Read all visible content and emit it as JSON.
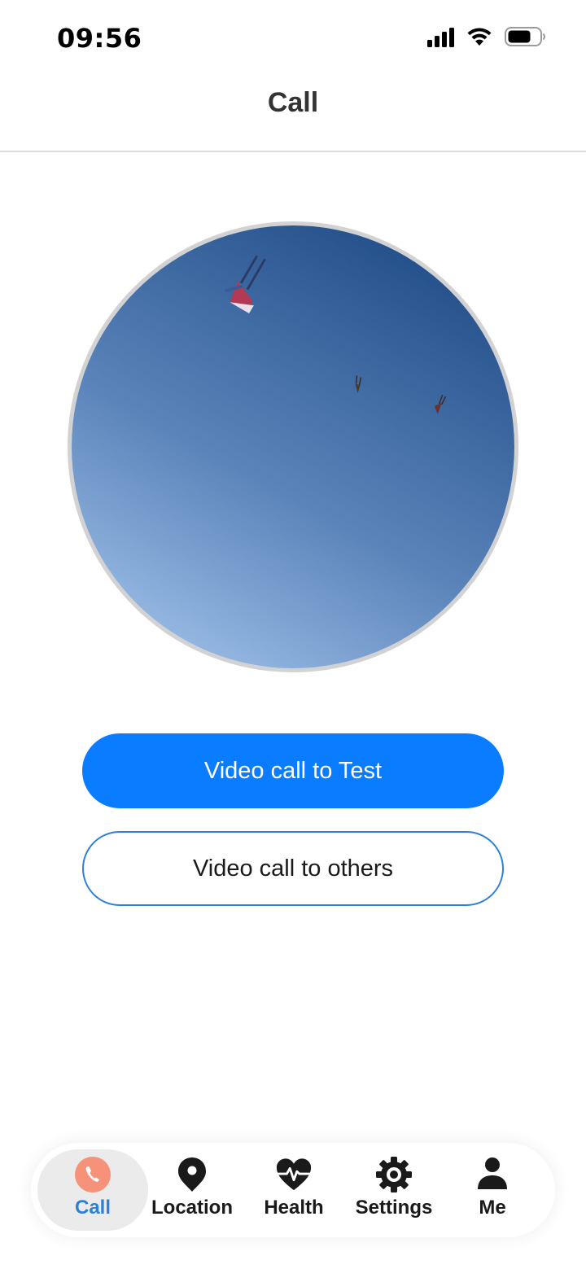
{
  "status_bar": {
    "time": "09:56"
  },
  "header": {
    "title": "Call"
  },
  "actions": {
    "primary_label": "Video call to Test",
    "secondary_label": "Video call to others"
  },
  "tabs": [
    {
      "label": "Call",
      "icon": "phone-icon",
      "active": true
    },
    {
      "label": "Location",
      "icon": "location-pin-icon",
      "active": false
    },
    {
      "label": "Health",
      "icon": "heart-pulse-icon",
      "active": false
    },
    {
      "label": "Settings",
      "icon": "gear-icon",
      "active": false
    },
    {
      "label": "Me",
      "icon": "person-icon",
      "active": false
    }
  ],
  "colors": {
    "accent": "#0a7cff",
    "outline": "#2d80d8",
    "call_icon": "#f7927a"
  }
}
